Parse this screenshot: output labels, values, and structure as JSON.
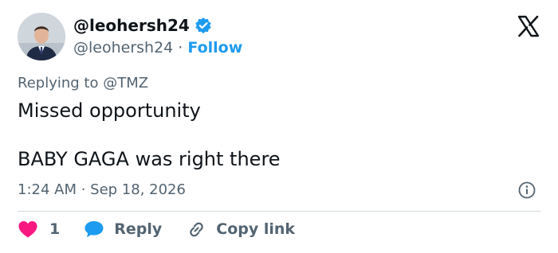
{
  "author": {
    "display_name": "@leohersh24",
    "handle": "@leohersh24",
    "separator": " · ",
    "follow_label": "Follow",
    "verified": true,
    "verified_color": "#1d9bf0"
  },
  "platform_icon": "x-logo-icon",
  "tweet": {
    "replying_to": "Replying to @TMZ",
    "lines": [
      "Missed opportunity",
      "BABY GAGA was right there"
    ],
    "timestamp": "1:24 AM · Sep 18, 2026"
  },
  "actions": {
    "like_count": "1",
    "like_color": "#f91880",
    "reply_label": "Reply",
    "reply_color": "#1d9bf0",
    "copy_label": "Copy link"
  },
  "icons": [
    "verified-badge-icon",
    "x-logo-icon",
    "info-icon",
    "heart-icon",
    "speech-bubble-icon",
    "link-icon"
  ]
}
